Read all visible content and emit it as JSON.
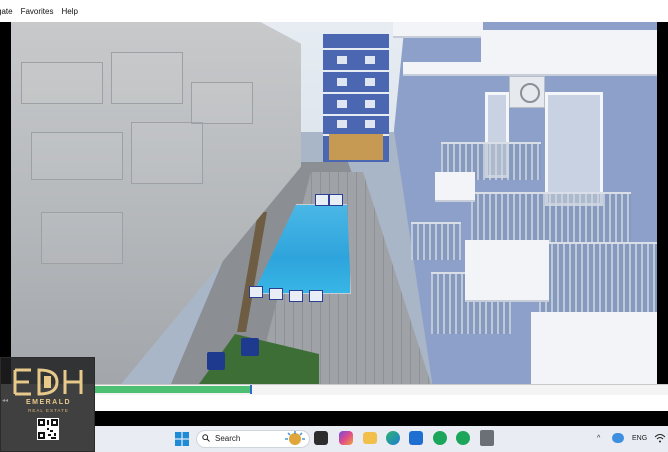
{
  "menu": {
    "items": [
      "gate",
      "Favorites",
      "Help"
    ]
  },
  "player": {
    "progress_fraction": 0.27
  },
  "watermark": {
    "brand_name": "EMERALD",
    "brand_tagline": "REAL ESTATE"
  },
  "taskbar": {
    "search_placeholder": "Search",
    "language": "ENG"
  },
  "colors": {
    "progress_fill": "#4cbf72",
    "accent_blue": "#2e6cc7",
    "brand_gold": "#e7c98a",
    "taskbar_bg": "#e9edf3"
  }
}
